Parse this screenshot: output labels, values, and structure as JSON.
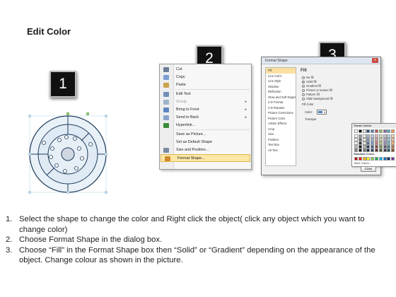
{
  "slide": {
    "title": "Edit Color"
  },
  "badges": [
    "1",
    "2",
    "3"
  ],
  "context_menu": {
    "items": [
      {
        "label": "Cut",
        "icon": "scissors-icon",
        "color": "#6b7f99"
      },
      {
        "label": "Copy",
        "icon": "copy-icon",
        "color": "#7a9fd4"
      },
      {
        "label": "Paste",
        "icon": "paste-icon",
        "color": "#c9a44a"
      },
      {
        "label": "Edit Text",
        "icon": "edit-text-icon",
        "color": "#6e8fb8"
      },
      {
        "label": "Group",
        "icon": "group-icon",
        "color": "#9fb4cc",
        "disabled": true,
        "submenu": true
      },
      {
        "label": "Bring to Front",
        "icon": "bring-front-icon",
        "color": "#5d86c2",
        "submenu": true
      },
      {
        "label": "Send to Back",
        "icon": "send-back-icon",
        "color": "#8aa4c9",
        "submenu": true
      },
      {
        "label": "Hyperlink...",
        "icon": "globe-icon",
        "color": "#3c8c3c"
      },
      {
        "label": "Save as Picture...",
        "icon": "",
        "color": ""
      },
      {
        "label": "Set as Default Shape",
        "icon": "",
        "color": ""
      },
      {
        "label": "Size and Position...",
        "icon": "size-icon",
        "color": "#7a8ba3"
      },
      {
        "label": "Format Shape...",
        "icon": "format-shape-icon",
        "color": "#d08a2c",
        "highlight": true
      }
    ]
  },
  "dialog": {
    "title": "Format Shape",
    "close_glyph": "x",
    "categories": [
      "Fill",
      "Line Color",
      "Line Style",
      "Shadow",
      "Reflection",
      "Glow and Soft Edges",
      "3-D Format",
      "3-D Rotation",
      "Picture Corrections",
      "Picture Color",
      "Artistic Effects",
      "Crop",
      "Size",
      "Position",
      "Text Box",
      "Alt Text"
    ],
    "pane_title": "Fill",
    "fill_options": [
      "No fill",
      "Solid fill",
      "Gradient fill",
      "Picture or texture fill",
      "Pattern fill",
      "Slide background fill"
    ],
    "fill_color_label": "Fill Color",
    "color_label": "Color:",
    "transparency_label": "Transpar",
    "theme_colors_label": "Theme Colors",
    "standard_colors_label": "Standard Colors",
    "more_colors_label": "More Colors...",
    "close_button": "Close",
    "theme_colors": [
      "#ffffff",
      "#000000",
      "#eeece1",
      "#1f497d",
      "#4f81bd",
      "#c0504d",
      "#9bbb59",
      "#8064a2",
      "#4bacc6",
      "#f79646"
    ],
    "standard_colors": [
      "#c00000",
      "#ff0000",
      "#ffc000",
      "#ffff00",
      "#92d050",
      "#00b050",
      "#00b0f0",
      "#0070c0",
      "#002060",
      "#7030a0"
    ]
  },
  "instructions": [
    {
      "num": "1.",
      "text": "Select the shape to change the color and Right click the object( click any object which you want to change color)"
    },
    {
      "num": "2.",
      "text": "Choose Format Shape in the dialog box."
    },
    {
      "num": "3.",
      "text": "Choose “Fill” in the Format Shape box then “Solid” or “Gradient” depending on the appearance of the object. Change colour as shown in the picture."
    }
  ]
}
